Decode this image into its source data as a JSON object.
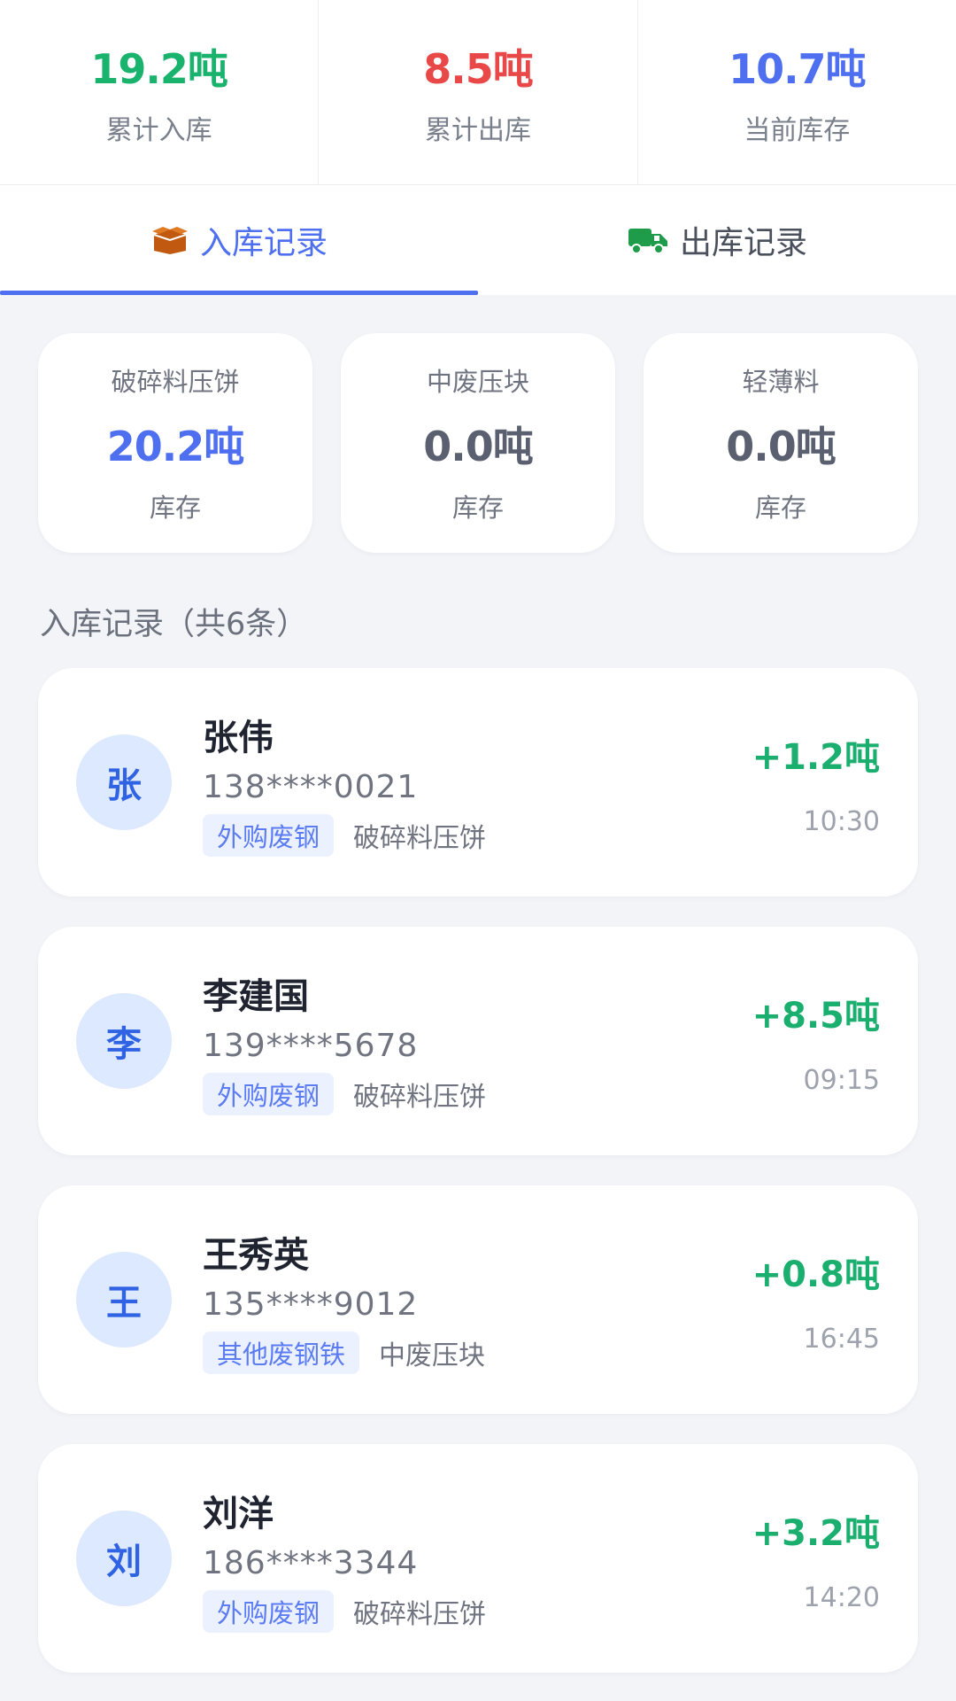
{
  "stats": [
    {
      "value": "19.2吨",
      "label": "累计入库",
      "color": "#19b36e"
    },
    {
      "value": "8.5吨",
      "label": "累计出库",
      "color": "#e94848"
    },
    {
      "value": "10.7吨",
      "label": "当前库存",
      "color": "#4e6ff0"
    }
  ],
  "tabs": [
    {
      "label": "入库记录",
      "icon": "box-icon",
      "active": true
    },
    {
      "label": "出库记录",
      "icon": "truck-icon",
      "active": false
    }
  ],
  "materials": [
    {
      "name": "破碎料压饼",
      "value": "20.2吨",
      "unit": "库存",
      "color": "#4e6ff0"
    },
    {
      "name": "中废压块",
      "value": "0.0吨",
      "unit": "库存",
      "color": "#5a6070"
    },
    {
      "name": "轻薄料",
      "value": "0.0吨",
      "unit": "库存",
      "color": "#5a6070"
    }
  ],
  "section_title": "入库记录（共6条）",
  "records": [
    {
      "avatar": "张",
      "name": "张伟",
      "phone": "138****0021",
      "tag": "外购废钢",
      "material": "破碎料压饼",
      "amount": "+1.2吨",
      "time": "10:30"
    },
    {
      "avatar": "李",
      "name": "李建国",
      "phone": "139****5678",
      "tag": "外购废钢",
      "material": "破碎料压饼",
      "amount": "+8.5吨",
      "time": "09:15"
    },
    {
      "avatar": "王",
      "name": "王秀英",
      "phone": "135****9012",
      "tag": "其他废钢铁",
      "material": "中废压块",
      "amount": "+0.8吨",
      "time": "16:45"
    },
    {
      "avatar": "刘",
      "name": "刘洋",
      "phone": "186****3344",
      "tag": "外购废钢",
      "material": "破碎料压饼",
      "amount": "+3.2吨",
      "time": "14:20"
    }
  ]
}
